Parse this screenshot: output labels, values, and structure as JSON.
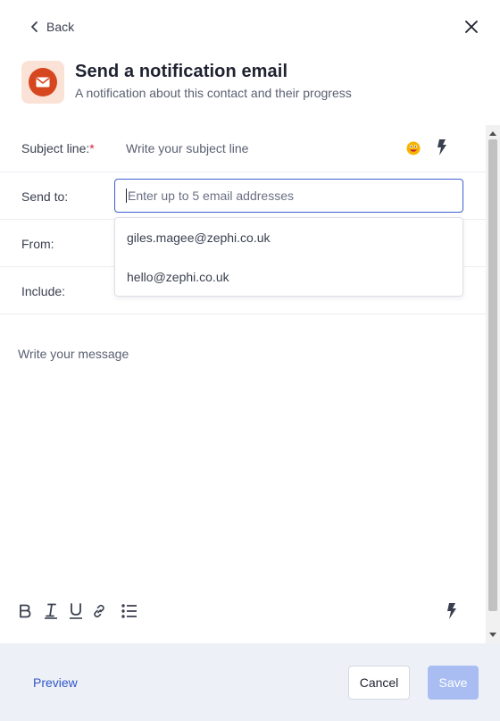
{
  "header": {
    "back_label": "Back",
    "title": "Send a notification email",
    "subtitle": "A notification about this contact and their progress"
  },
  "form": {
    "subject": {
      "label": "Subject line:",
      "required_mark": "*",
      "placeholder": "Write your subject line"
    },
    "send_to": {
      "label": "Send to:",
      "placeholder": "Enter up to 5 email addresses",
      "suggestions": [
        "giles.magee@zephi.co.uk",
        "hello@zephi.co.uk"
      ]
    },
    "from": {
      "label": "From:"
    },
    "include": {
      "label": "Include:"
    },
    "message": {
      "placeholder": "Write your message"
    }
  },
  "toolbar": {
    "icons": [
      "bold-icon",
      "italic-icon",
      "underline-icon",
      "link-icon",
      "bullet-list-icon",
      "bolt-icon"
    ]
  },
  "footer": {
    "preview_label": "Preview",
    "cancel_label": "Cancel",
    "save_label": "Save"
  },
  "colors": {
    "accent": "#2f56c7",
    "input_focus": "#3d5fd1",
    "brand_icon": "#d6471f",
    "brand_icon_bg": "#fbe2d6",
    "save_disabled": "#a9bdf2",
    "footer_bg": "#edf0f7",
    "required": "#d6233e"
  }
}
